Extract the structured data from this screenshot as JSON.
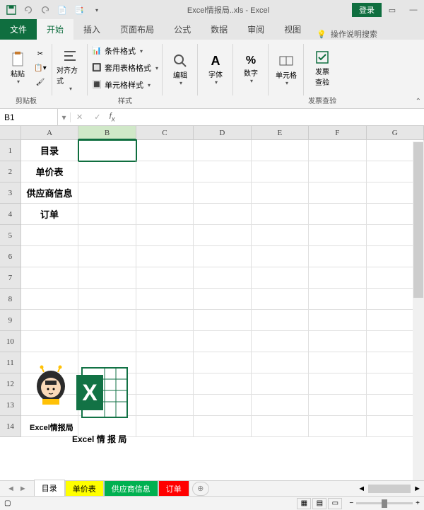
{
  "titlebar": {
    "filename": "Excel情报局..xls  -  Excel",
    "login": "登录"
  },
  "tabs": {
    "file": "文件",
    "home": "开始",
    "insert": "插入",
    "layout": "页面布局",
    "formula": "公式",
    "data": "数据",
    "review": "审阅",
    "view": "视图",
    "tellme": "操作说明搜索"
  },
  "ribbon": {
    "clipboard": {
      "label": "剪贴板",
      "paste": "粘贴"
    },
    "align": {
      "label": "对齐方式"
    },
    "styles": {
      "label": "样式",
      "cond": "条件格式",
      "table": "套用表格格式",
      "cell": "单元格样式"
    },
    "edit": {
      "label": "编辑"
    },
    "font": {
      "label": "字体"
    },
    "number": {
      "label": "数字"
    },
    "cells": {
      "label": "单元格"
    },
    "invoice": {
      "label": "发票查验",
      "btn": "发票\n查验"
    }
  },
  "namebox": {
    "ref": "B1",
    "formula": ""
  },
  "grid": {
    "cols": [
      "A",
      "B",
      "C",
      "D",
      "E",
      "F",
      "G"
    ],
    "rows": [
      {
        "n": "1",
        "cells": [
          "目录",
          "",
          "",
          "",
          "",
          "",
          ""
        ]
      },
      {
        "n": "2",
        "cells": [
          "单价表",
          "",
          "",
          "",
          "",
          "",
          ""
        ]
      },
      {
        "n": "3",
        "cells": [
          "供应商信息",
          "",
          "",
          "",
          "",
          "",
          ""
        ]
      },
      {
        "n": "4",
        "cells": [
          "订单",
          "",
          "",
          "",
          "",
          "",
          ""
        ]
      },
      {
        "n": "5",
        "cells": [
          "",
          "",
          "",
          "",
          "",
          "",
          ""
        ]
      },
      {
        "n": "6",
        "cells": [
          "",
          "",
          "",
          "",
          "",
          "",
          ""
        ]
      },
      {
        "n": "7",
        "cells": [
          "",
          "",
          "",
          "",
          "",
          "",
          ""
        ]
      },
      {
        "n": "8",
        "cells": [
          "",
          "",
          "",
          "",
          "",
          "",
          ""
        ]
      },
      {
        "n": "9",
        "cells": [
          "",
          "",
          "",
          "",
          "",
          "",
          ""
        ]
      },
      {
        "n": "10",
        "cells": [
          "",
          "",
          "",
          "",
          "",
          "",
          ""
        ]
      },
      {
        "n": "11",
        "cells": [
          "",
          "",
          "",
          "",
          "",
          "",
          ""
        ]
      },
      {
        "n": "12",
        "cells": [
          "",
          "",
          "",
          "",
          "",
          "",
          ""
        ]
      },
      {
        "n": "13",
        "cells": [
          "",
          "",
          "",
          "",
          "",
          "",
          ""
        ]
      },
      {
        "n": "14",
        "cells": [
          "",
          "",
          "",
          "",
          "",
          "",
          ""
        ]
      }
    ]
  },
  "overlay": {
    "text1": "Excel情报局",
    "text2": "Excel 情 报 局"
  },
  "sheets": {
    "s1": "目录",
    "s2": "单价表",
    "s3": "供应商信息",
    "s4": "订单"
  },
  "status": {
    "ready": ""
  }
}
